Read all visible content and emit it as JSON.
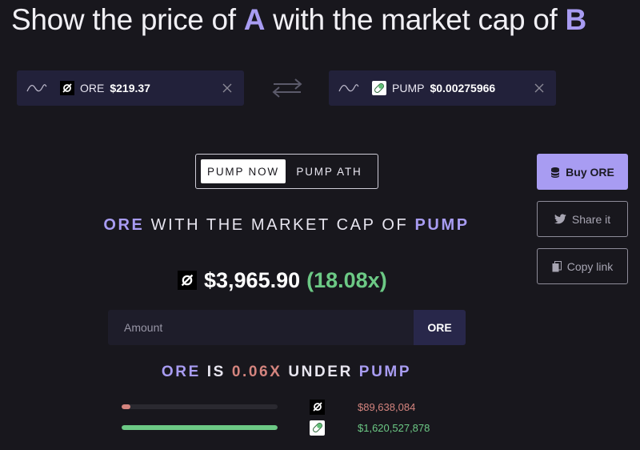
{
  "headline": {
    "prefix": "Show the price of ",
    "a": "A",
    "middle": " with the market cap of ",
    "b": "B"
  },
  "token_a": {
    "symbol": "ORE",
    "price": "$219.37",
    "icon": "ore-icon"
  },
  "token_b": {
    "symbol": "PUMP",
    "price": "$0.00275966",
    "icon": "pump-pill-icon"
  },
  "toggle": {
    "now_label": "PUMP NOW",
    "ath_label": "PUMP ATH",
    "selected": "PUMP NOW"
  },
  "actions": {
    "buy_label": "Buy ORE",
    "share_label": "Share it",
    "copy_label": "Copy link"
  },
  "cap_title": {
    "a": "ORE",
    "middle": " WITH THE MARKET CAP OF ",
    "b": "PUMP"
  },
  "result": {
    "price": "$3,965.90",
    "multiple": "(18.08x)"
  },
  "amount": {
    "placeholder": "Amount",
    "value": "",
    "unit": "ORE"
  },
  "comparison": {
    "a": "ORE",
    "is": " IS ",
    "ratio": "0.06X",
    "under": " UNDER ",
    "b": "PUMP"
  },
  "market_caps": [
    {
      "token": "ORE",
      "value": "$89,638,084",
      "fill_fraction": 0.055,
      "color": "#d4847e"
    },
    {
      "token": "PUMP",
      "value": "$1,620,527,878",
      "fill_fraction": 1.0,
      "color": "#6cc985"
    }
  ],
  "colors": {
    "accent": "#a89cf2",
    "positive": "#6cc985",
    "negative": "#d4847e",
    "background": "#18171d"
  }
}
